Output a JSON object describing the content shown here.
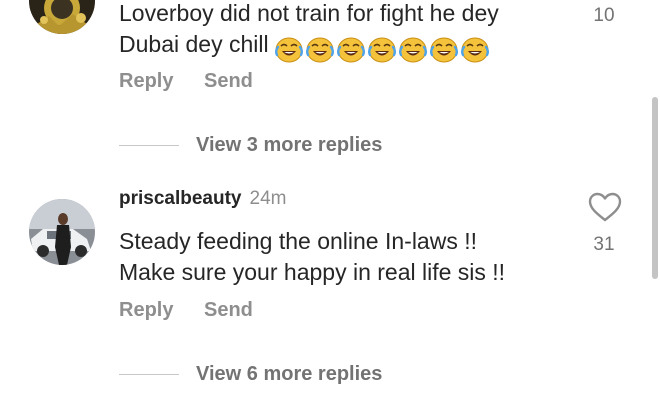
{
  "comments": [
    {
      "text_line1": "Loverboy did not train for fight he dey",
      "text_line2": "Dubai dey chill",
      "emoji_count": 7,
      "emoji_icon": "face-with-tears-of-joy-icon",
      "likes": "10",
      "reply_label": "Reply",
      "send_label": "Send",
      "view_replies": "View 3 more replies"
    },
    {
      "username": "priscalbeauty",
      "time": "24m",
      "text_line1": "Steady feeding the online In-laws !!",
      "text_line2": "Make sure your happy in real life sis !!",
      "likes": "31",
      "heart_icon": "heart-outline-icon",
      "reply_label": "Reply",
      "send_label": "Send",
      "view_replies": "View 6 more replies"
    }
  ],
  "colors": {
    "text": "#262626",
    "secondary": "#8e8e8e",
    "emoji_face": "#f5c33b"
  }
}
